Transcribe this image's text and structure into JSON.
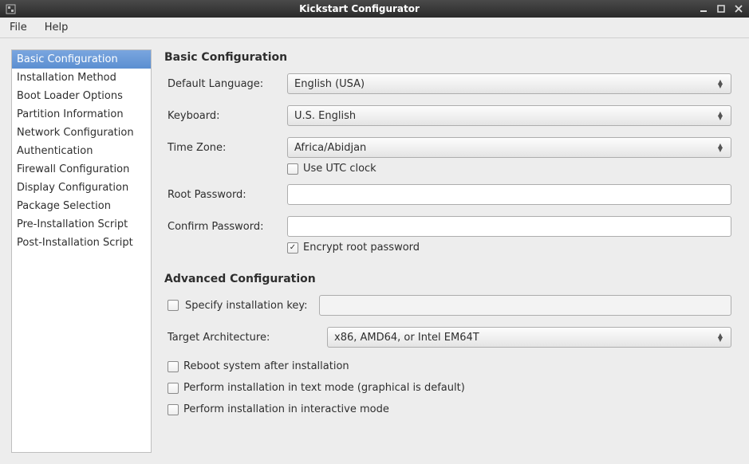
{
  "window": {
    "title": "Kickstart Configurator"
  },
  "menu": {
    "file": "File",
    "help": "Help"
  },
  "sidebar": {
    "items": [
      {
        "label": "Basic Configuration"
      },
      {
        "label": "Installation Method"
      },
      {
        "label": "Boot Loader Options"
      },
      {
        "label": "Partition Information"
      },
      {
        "label": "Network Configuration"
      },
      {
        "label": "Authentication"
      },
      {
        "label": "Firewall Configuration"
      },
      {
        "label": "Display Configuration"
      },
      {
        "label": "Package Selection"
      },
      {
        "label": "Pre-Installation Script"
      },
      {
        "label": "Post-Installation Script"
      }
    ],
    "selected_index": 0
  },
  "basic": {
    "title": "Basic Configuration",
    "default_language_label": "Default Language:",
    "default_language_value": "English (USA)",
    "keyboard_label": "Keyboard:",
    "keyboard_value": "U.S. English",
    "timezone_label": "Time Zone:",
    "timezone_value": "Africa/Abidjan",
    "utc_label": "Use UTC clock",
    "utc_checked": false,
    "root_pw_label": "Root Password:",
    "root_pw_value": "",
    "confirm_pw_label": "Confirm Password:",
    "confirm_pw_value": "",
    "encrypt_label": "Encrypt root password",
    "encrypt_checked": true
  },
  "advanced": {
    "title": "Advanced Configuration",
    "specify_key_label": "Specify installation key:",
    "specify_key_checked": false,
    "specify_key_value": "",
    "target_arch_label": "Target Architecture:",
    "target_arch_value": "x86, AMD64, or Intel EM64T",
    "reboot_label": "Reboot system after installation",
    "reboot_checked": false,
    "text_mode_label": "Perform installation in text mode (graphical is default)",
    "text_mode_checked": false,
    "interactive_label": "Perform installation in interactive mode",
    "interactive_checked": false
  }
}
